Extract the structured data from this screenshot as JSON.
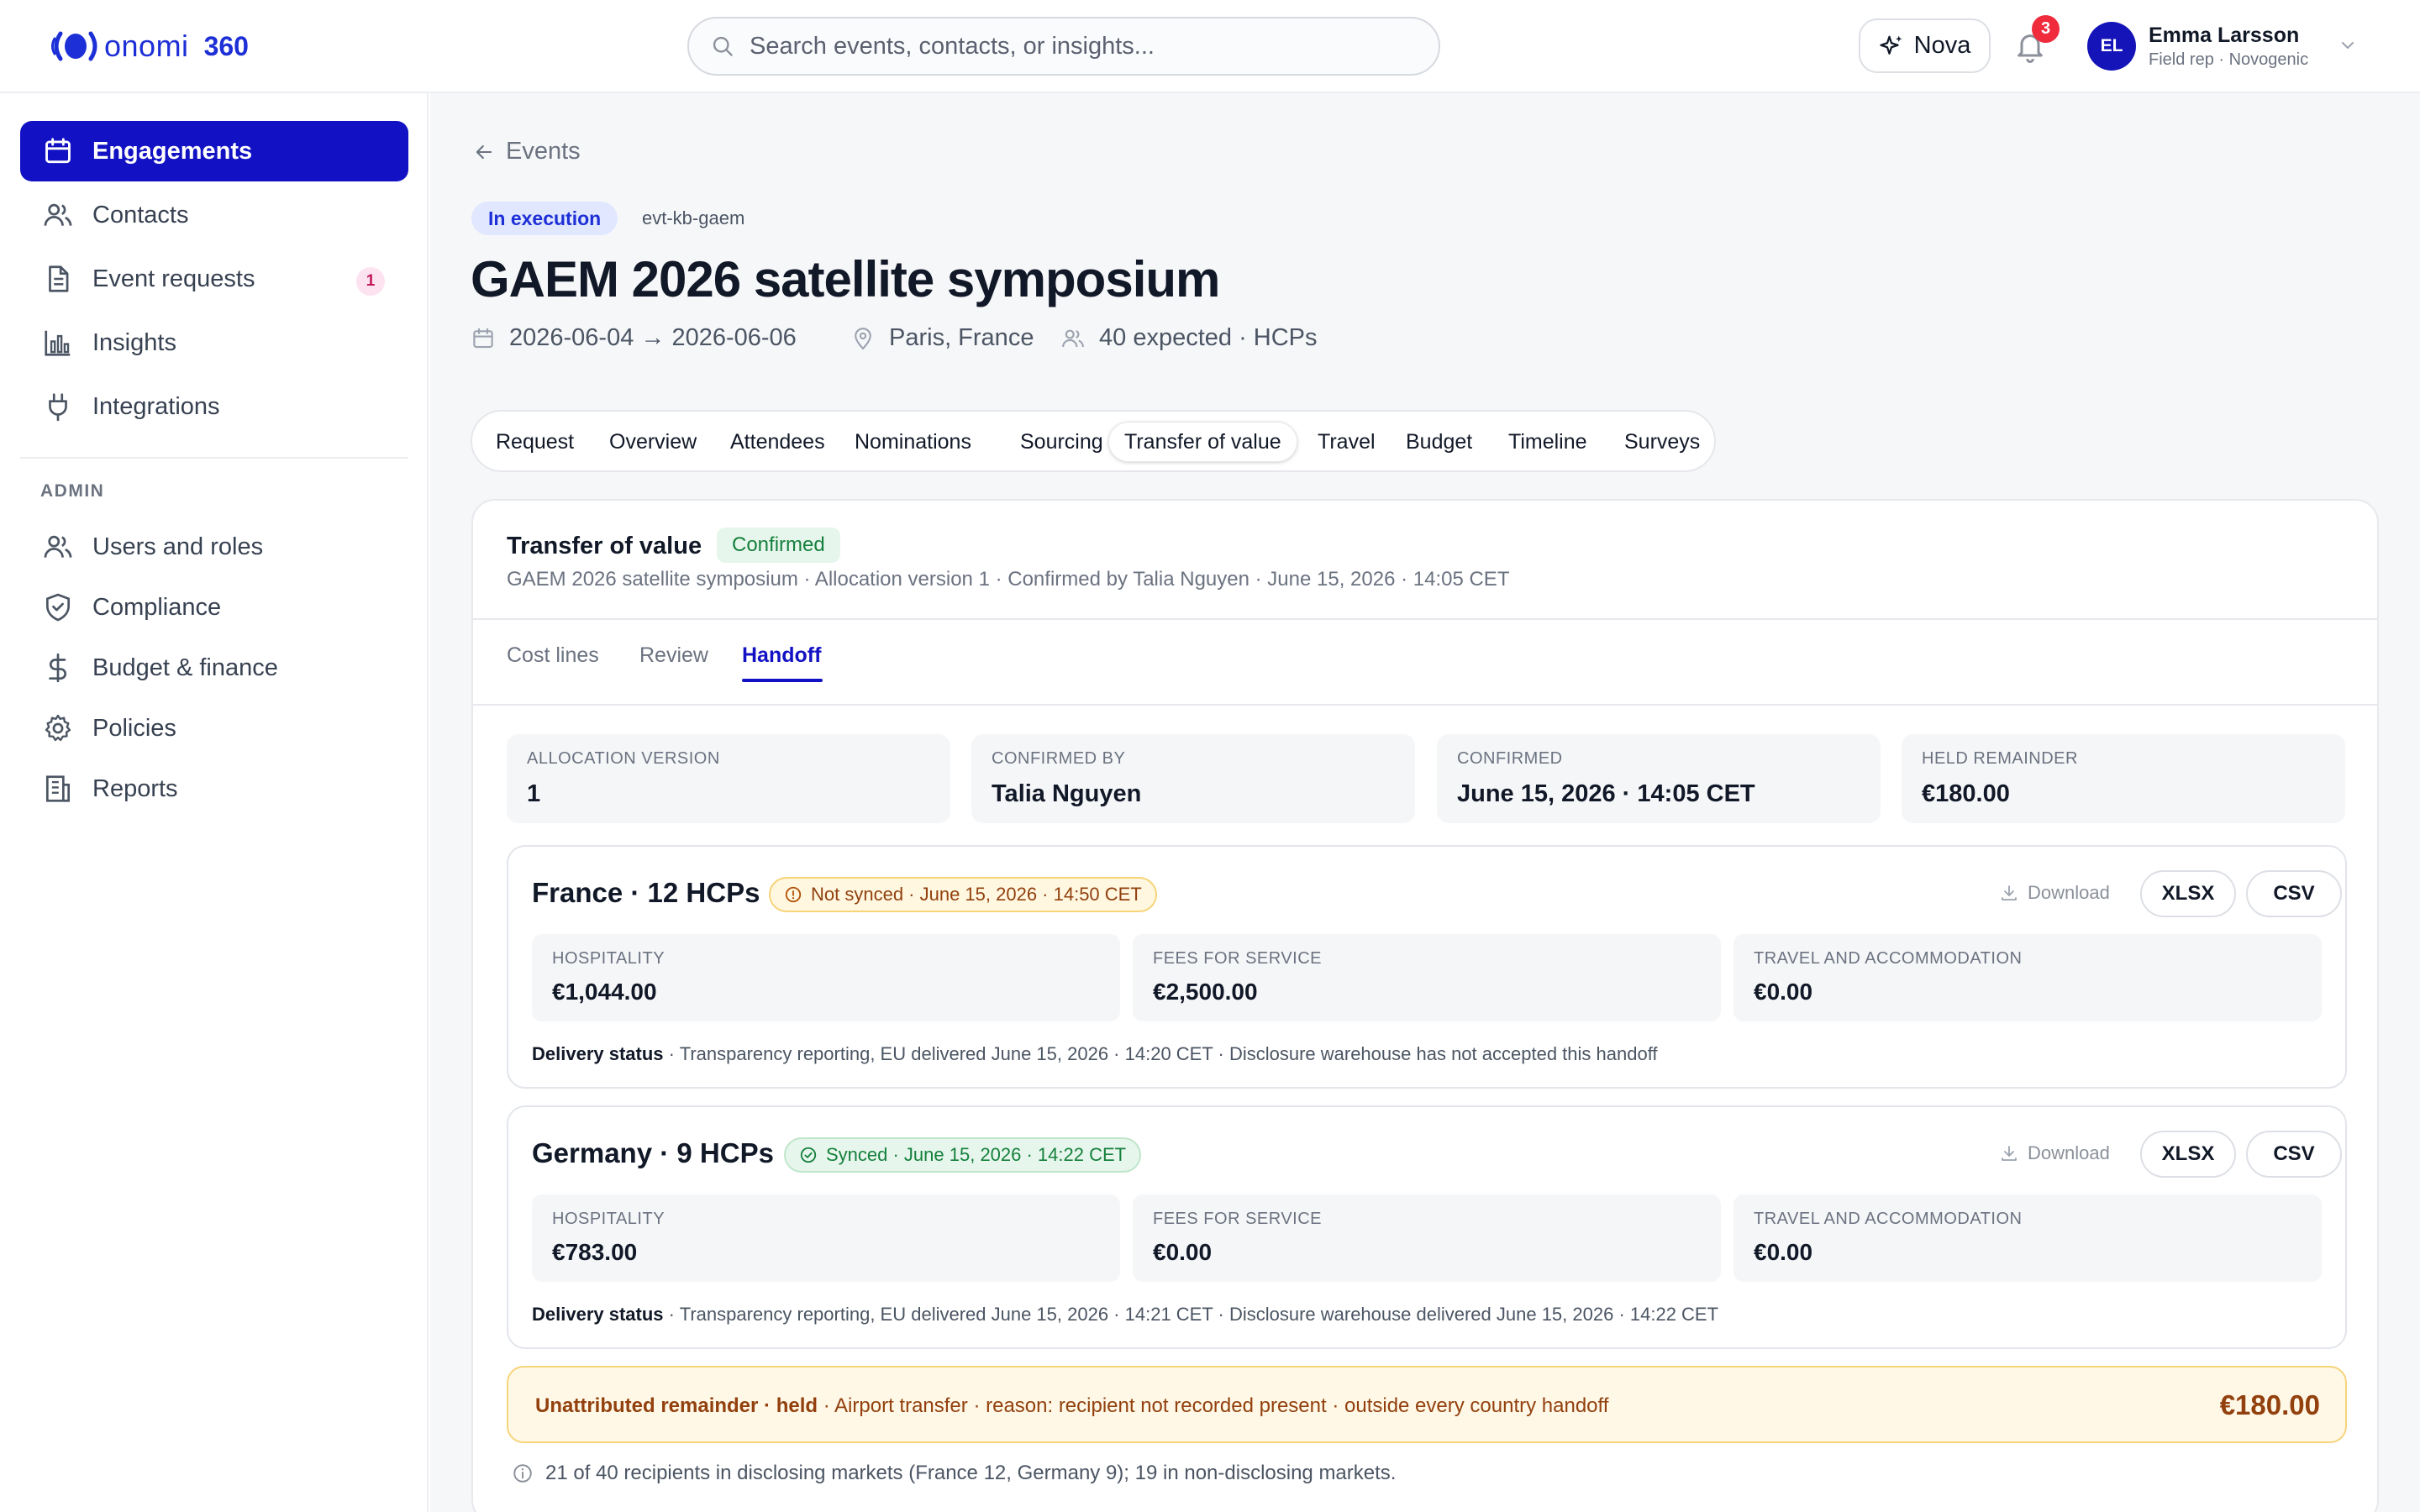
{
  "brand": {
    "name": "onomi",
    "suffix": "360",
    "color": "#1d2fd6"
  },
  "search": {
    "placeholder": "Search events, contacts, or insights..."
  },
  "header": {
    "nova_label": "Nova",
    "notification_count": "3",
    "user": {
      "initials": "EL",
      "name": "Emma Larsson",
      "role": "Field rep · Novogenic"
    }
  },
  "sidebar": {
    "items": [
      {
        "label": "Engagements",
        "icon": "calendar-icon",
        "active": true
      },
      {
        "label": "Contacts",
        "icon": "users-icon"
      },
      {
        "label": "Event requests",
        "icon": "document-icon",
        "badge": "1"
      },
      {
        "label": "Insights",
        "icon": "bar-chart-icon"
      },
      {
        "label": "Integrations",
        "icon": "plug-icon"
      }
    ],
    "admin_section": "ADMIN",
    "admin_items": [
      {
        "label": "Users and roles",
        "icon": "users-icon"
      },
      {
        "label": "Compliance",
        "icon": "shield-icon"
      },
      {
        "label": "Budget & finance",
        "icon": "dollar-icon"
      },
      {
        "label": "Policies",
        "icon": "gear-icon"
      },
      {
        "label": "Reports",
        "icon": "building-icon"
      }
    ]
  },
  "event": {
    "back_label": "Events",
    "status": "In execution",
    "id": "evt-kb-gaem",
    "title": "GAEM 2026 satellite symposium",
    "dates": "2026-06-04 → 2026-06-06",
    "location": "Paris, France",
    "attendance": "40 expected · HCPs"
  },
  "tabs": [
    "Request",
    "Overview",
    "Attendees",
    "Nominations",
    "Sourcing",
    "Transfer of value",
    "Travel",
    "Budget",
    "Timeline",
    "Surveys"
  ],
  "active_tab": "Transfer of value",
  "tov": {
    "title": "Transfer of value",
    "status": "Confirmed",
    "subtitle": "GAEM 2026 satellite symposium · Allocation version 1 · Confirmed by Talia Nguyen · June 15, 2026 · 14:05 CET",
    "subtabs": [
      "Cost lines",
      "Review",
      "Handoff"
    ],
    "active_subtab": "Handoff",
    "stats": [
      {
        "label": "ALLOCATION VERSION",
        "value": "1"
      },
      {
        "label": "CONFIRMED BY",
        "value": "Talia Nguyen"
      },
      {
        "label": "CONFIRMED",
        "value": "June 15, 2026 · 14:05 CET"
      },
      {
        "label": "HELD REMAINDER",
        "value": "€180.00"
      }
    ],
    "download_label": "Download",
    "formats": [
      "XLSX",
      "CSV"
    ],
    "delivery_label": "Delivery status",
    "countries": [
      {
        "name": "France · 12 HCPs",
        "sync": "Not synced · June 15, 2026 · 14:50 CET",
        "synced": false,
        "amounts": [
          {
            "label": "HOSPITALITY",
            "value": "€1,044.00"
          },
          {
            "label": "FEES FOR SERVICE",
            "value": "€2,500.00"
          },
          {
            "label": "TRAVEL AND ACCOMMODATION",
            "value": "€0.00"
          }
        ],
        "delivery": "· Transparency reporting, EU delivered June 15, 2026 · 14:20 CET · Disclosure warehouse has not accepted this handoff"
      },
      {
        "name": "Germany · 9 HCPs",
        "sync": "Synced · June 15, 2026 · 14:22 CET",
        "synced": true,
        "amounts": [
          {
            "label": "HOSPITALITY",
            "value": "€783.00"
          },
          {
            "label": "FEES FOR SERVICE",
            "value": "€0.00"
          },
          {
            "label": "TRAVEL AND ACCOMMODATION",
            "value": "€0.00"
          }
        ],
        "delivery": "· Transparency reporting, EU delivered June 15, 2026 · 14:21 CET · Disclosure warehouse delivered June 15, 2026 · 14:22 CET"
      }
    ],
    "held": {
      "title": "Unattributed remainder · held",
      "detail": " · Airport transfer · reason: recipient not recorded present · outside every country handoff",
      "amount": "€180.00"
    },
    "footnote": "21 of 40 recipients in disclosing markets (France 12, Germany 9); 19 in non-disclosing markets."
  }
}
